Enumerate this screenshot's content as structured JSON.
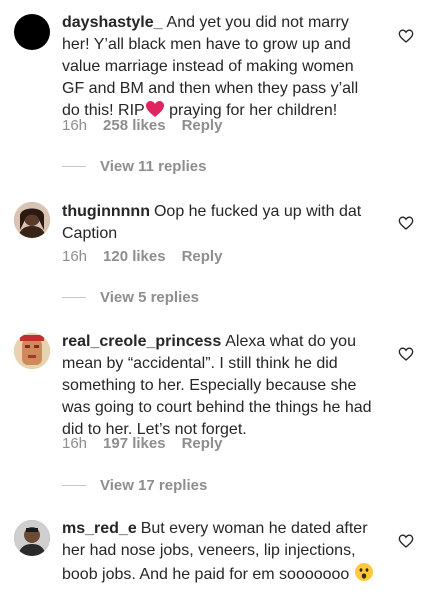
{
  "comments": [
    {
      "username": "dayshastyle_",
      "text": "And yet you did not marry her! Y’all black men have to grow up and value marriage instead of making women GF and BM and then when they pass y’all do this! RIP",
      "text_after_emoji": " praying for her children!",
      "time": "16h",
      "likes": "258 likes",
      "reply_label": "Reply",
      "view_replies": "View 11 replies"
    },
    {
      "username": "thuginnnnn",
      "text": "Oop he fucked ya up with dat Caption",
      "time": "16h",
      "likes": "120 likes",
      "reply_label": "Reply",
      "view_replies": "View 5 replies"
    },
    {
      "username": "real_creole_princess",
      "text": "Alexa what do you mean by “accidental”. I still think he did something to her. Especially because she was going to court behind the things he had did to her. Let’s not forget.",
      "time": "16h",
      "likes": "197 likes",
      "reply_label": "Reply",
      "view_replies": "View 17 replies"
    },
    {
      "username": "ms_red_e",
      "text": "But every woman he dated after her had nose jobs, veneers, lip injections, boob jobs. And he paid for em sooooooo"
    }
  ],
  "icons": {
    "like": "heart-outline-icon",
    "inline_heart": "red-heart-emoji",
    "inline_face": "astonished-face-emoji"
  },
  "colors": {
    "text": "#262626",
    "meta": "#8e8e8e",
    "red_heart": "#e0245e",
    "emoji_yellow": "#ffc83d"
  }
}
